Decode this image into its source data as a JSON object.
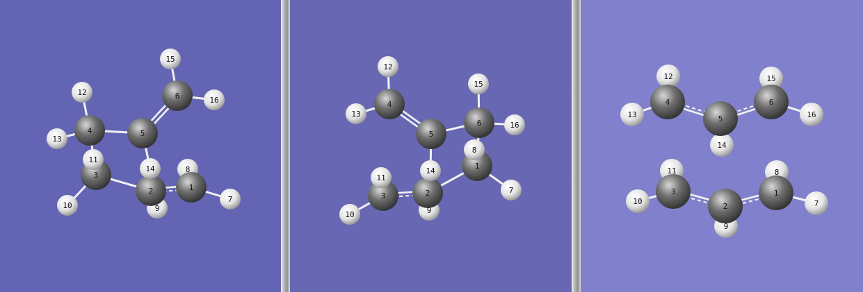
{
  "colors": {
    "panel_1_background": "#6464b4",
    "panel_2_background": "#6767b4",
    "panel_3_background": "#8080cc",
    "carbon": "#6e6e6e",
    "hydrogen": "#e4e4e4",
    "bond": "#f2f2f2"
  },
  "panels": [
    {
      "atoms": [
        {
          "label": "1",
          "element": "C"
        },
        {
          "label": "2",
          "element": "C"
        },
        {
          "label": "3",
          "element": "C"
        },
        {
          "label": "4",
          "element": "C"
        },
        {
          "label": "5",
          "element": "C"
        },
        {
          "label": "6",
          "element": "C"
        },
        {
          "label": "7",
          "element": "H"
        },
        {
          "label": "8",
          "element": "H"
        },
        {
          "label": "9",
          "element": "H"
        },
        {
          "label": "10",
          "element": "H"
        },
        {
          "label": "11",
          "element": "H"
        },
        {
          "label": "12",
          "element": "H"
        },
        {
          "label": "13",
          "element": "H"
        },
        {
          "label": "14",
          "element": "H"
        },
        {
          "label": "15",
          "element": "H"
        },
        {
          "label": "16",
          "element": "H"
        }
      ],
      "bonds": [
        {
          "a": "5",
          "b": "6",
          "order": "double"
        },
        {
          "a": "1",
          "b": "2",
          "order": "partial"
        },
        {
          "a": "2",
          "b": "3",
          "order": "single"
        },
        {
          "a": "4",
          "b": "5",
          "order": "single"
        },
        {
          "a": "3",
          "b": "4",
          "order": "single"
        }
      ]
    },
    {
      "atoms": [
        {
          "label": "1",
          "element": "C"
        },
        {
          "label": "2",
          "element": "C"
        },
        {
          "label": "3",
          "element": "C"
        },
        {
          "label": "4",
          "element": "C"
        },
        {
          "label": "5",
          "element": "C"
        },
        {
          "label": "6",
          "element": "C"
        },
        {
          "label": "7",
          "element": "H"
        },
        {
          "label": "8",
          "element": "H"
        },
        {
          "label": "9",
          "element": "H"
        },
        {
          "label": "10",
          "element": "H"
        },
        {
          "label": "11",
          "element": "H"
        },
        {
          "label": "12",
          "element": "H"
        },
        {
          "label": "13",
          "element": "H"
        },
        {
          "label": "14",
          "element": "H"
        },
        {
          "label": "15",
          "element": "H"
        },
        {
          "label": "16",
          "element": "H"
        }
      ],
      "bonds": [
        {
          "a": "4",
          "b": "5",
          "order": "double"
        },
        {
          "a": "5",
          "b": "6",
          "order": "single"
        },
        {
          "a": "2",
          "b": "3",
          "order": "partial"
        },
        {
          "a": "1",
          "b": "2",
          "order": "single"
        },
        {
          "a": "1",
          "b": "6",
          "order": "single"
        }
      ]
    },
    {
      "atoms": [
        {
          "label": "1",
          "element": "C"
        },
        {
          "label": "2",
          "element": "C"
        },
        {
          "label": "3",
          "element": "C"
        },
        {
          "label": "4",
          "element": "C"
        },
        {
          "label": "5",
          "element": "C"
        },
        {
          "label": "6",
          "element": "C"
        },
        {
          "label": "7",
          "element": "H"
        },
        {
          "label": "8",
          "element": "H"
        },
        {
          "label": "9",
          "element": "H"
        },
        {
          "label": "10",
          "element": "H"
        },
        {
          "label": "11",
          "element": "H"
        },
        {
          "label": "12",
          "element": "H"
        },
        {
          "label": "13",
          "element": "H"
        },
        {
          "label": "14",
          "element": "H"
        },
        {
          "label": "15",
          "element": "H"
        },
        {
          "label": "16",
          "element": "H"
        }
      ],
      "bonds": [
        {
          "a": "4",
          "b": "5",
          "order": "partial"
        },
        {
          "a": "5",
          "b": "6",
          "order": "partial"
        },
        {
          "a": "2",
          "b": "3",
          "order": "partial"
        },
        {
          "a": "1",
          "b": "2",
          "order": "partial"
        }
      ]
    }
  ]
}
